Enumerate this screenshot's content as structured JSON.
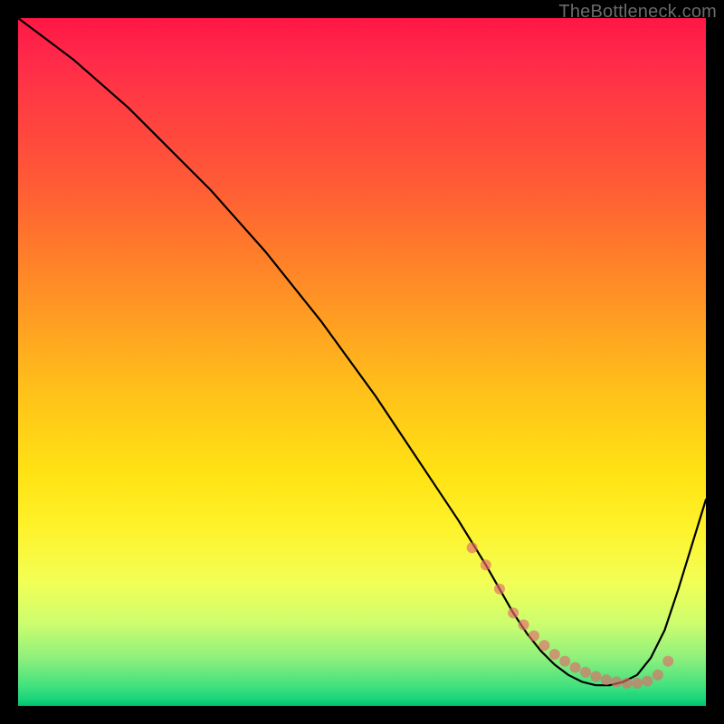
{
  "watermark": "TheBottleneck.com",
  "colors": {
    "marker": "#e46a6a",
    "line": "#000000",
    "background_black": "#000000"
  },
  "chart_data": {
    "type": "line",
    "title": "",
    "xlabel": "",
    "ylabel": "",
    "xlim": [
      0,
      100
    ],
    "ylim": [
      0,
      100
    ],
    "grid": false,
    "legend": false,
    "series": [
      {
        "name": "curve",
        "x": [
          0,
          4,
          8,
          12,
          16,
          20,
          24,
          28,
          32,
          36,
          40,
          44,
          48,
          52,
          56,
          60,
          64,
          68,
          70,
          72,
          74,
          76,
          78,
          80,
          82,
          84,
          86,
          88,
          90,
          92,
          94,
          96,
          100
        ],
        "y": [
          100,
          97,
          94,
          90.5,
          87,
          83,
          79,
          75,
          70.5,
          66,
          61,
          56,
          50.5,
          45,
          39,
          33,
          27,
          20.5,
          17,
          13.5,
          10.5,
          8,
          6,
          4.5,
          3.5,
          3,
          3,
          3.5,
          4.5,
          7,
          11,
          17,
          30
        ]
      }
    ],
    "markers": {
      "name": "highlight-points",
      "x": [
        66,
        68,
        70,
        72,
        73.5,
        75,
        76.5,
        78,
        79.5,
        81,
        82.5,
        84,
        85.5,
        87,
        88.5,
        90,
        91.5,
        93,
        94.5
      ],
      "y": [
        23,
        20.5,
        17,
        13.5,
        11.8,
        10.2,
        8.8,
        7.5,
        6.5,
        5.6,
        4.9,
        4.3,
        3.8,
        3.5,
        3.3,
        3.3,
        3.6,
        4.5,
        6.5
      ]
    }
  }
}
